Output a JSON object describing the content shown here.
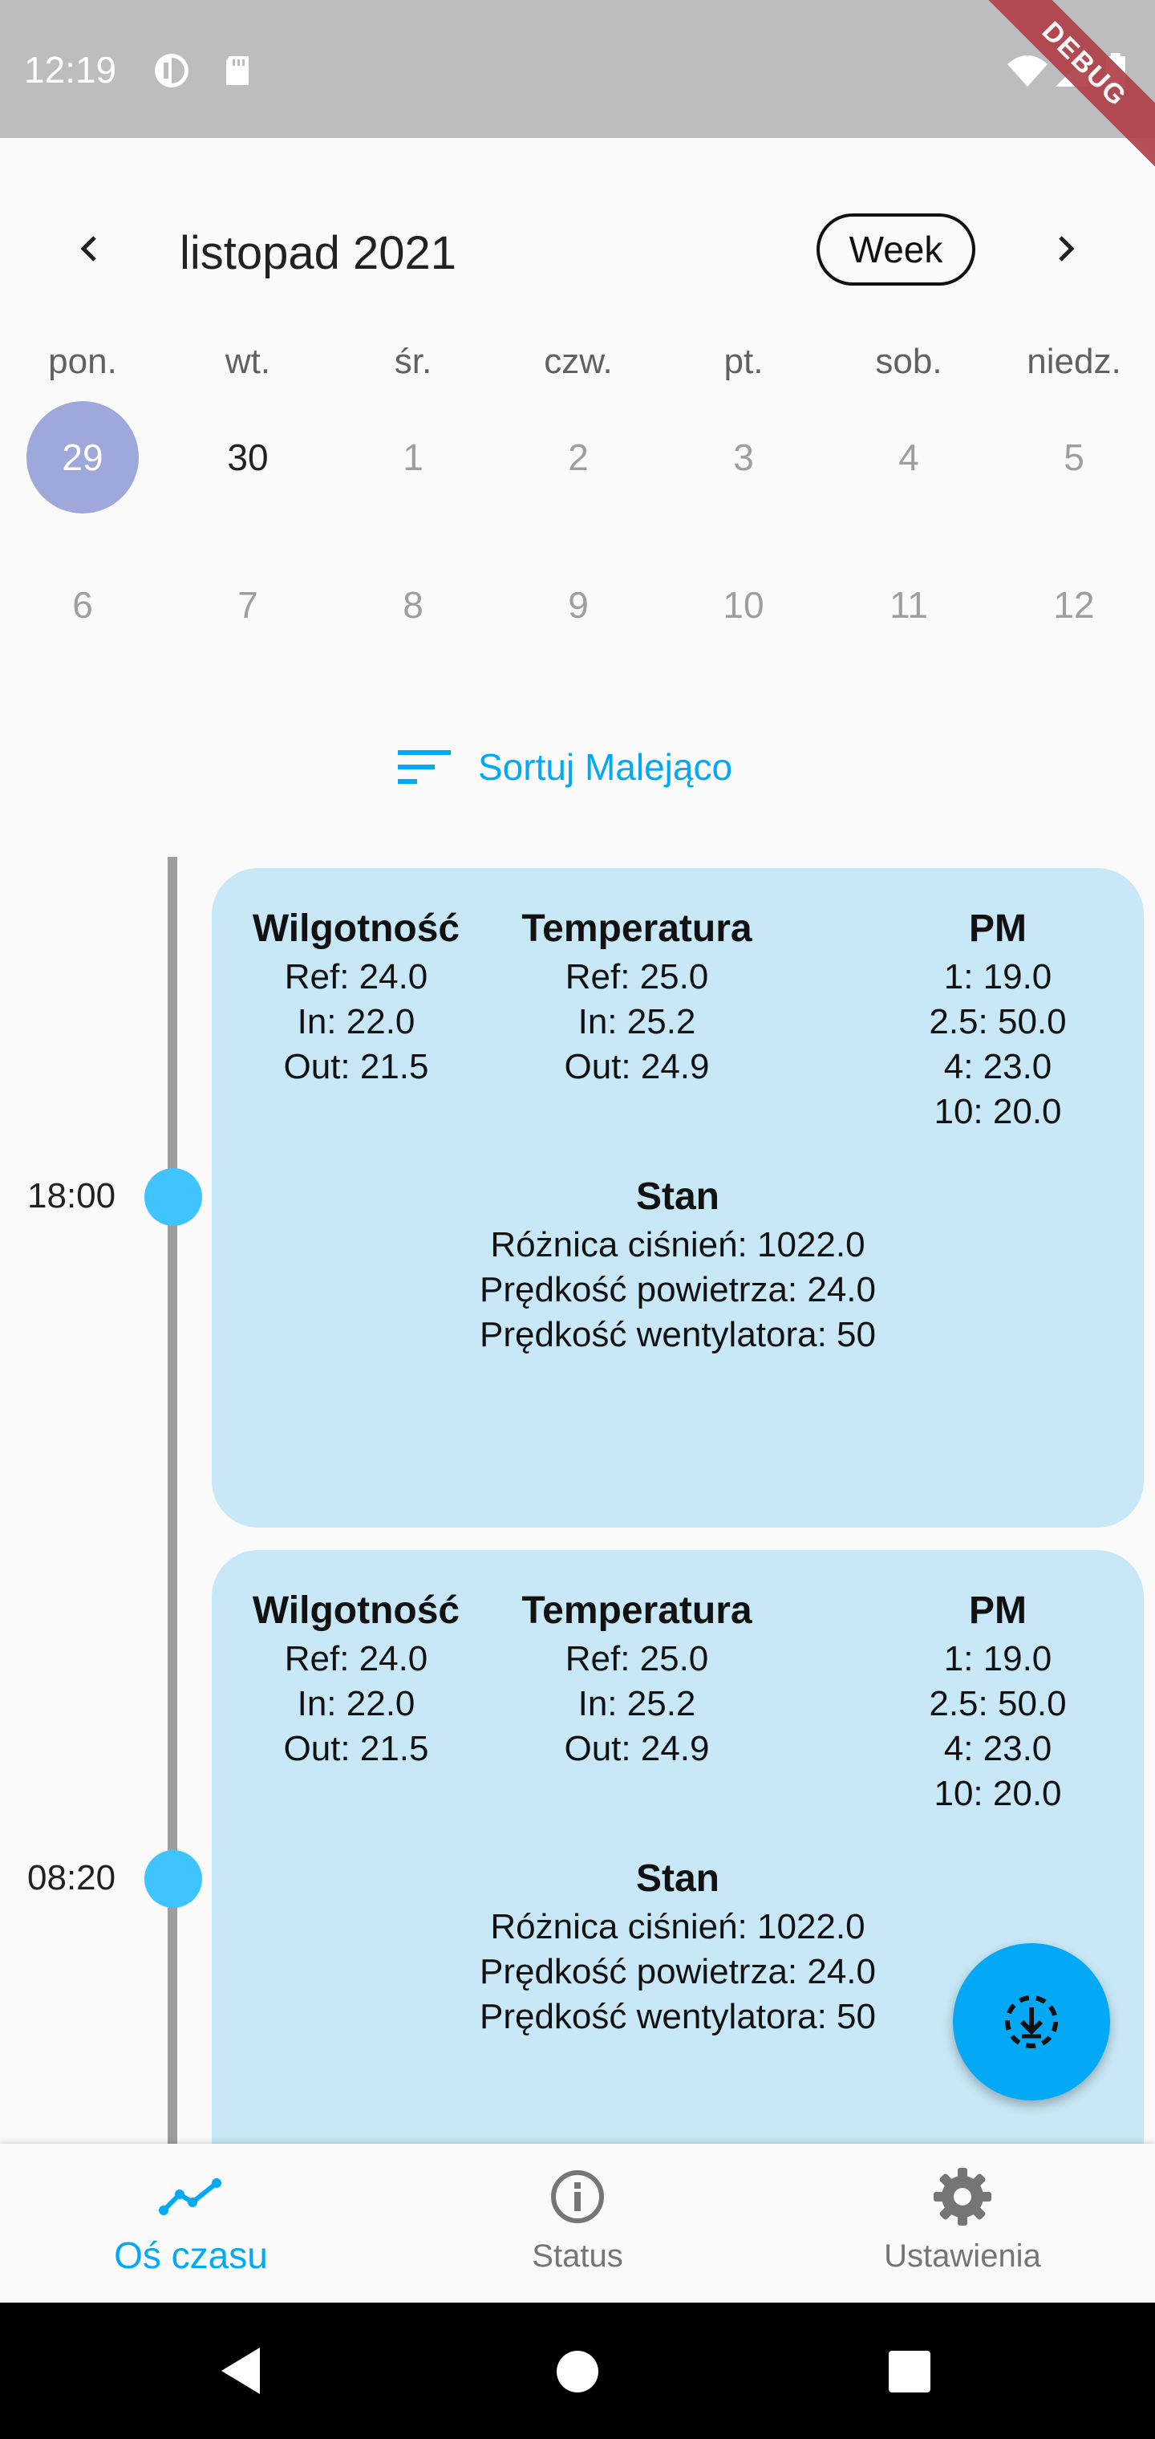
{
  "status_bar": {
    "time": "12:19",
    "debug_label": "DEBUG"
  },
  "calendar": {
    "month_title": "listopad 2021",
    "view_button": "Week",
    "weekdays": [
      "pon.",
      "wt.",
      "śr.",
      "czw.",
      "pt.",
      "sob.",
      "niedz."
    ],
    "week1": [
      "29",
      "30",
      "1",
      "2",
      "3",
      "4",
      "5"
    ],
    "week2": [
      "6",
      "7",
      "8",
      "9",
      "10",
      "11",
      "12"
    ]
  },
  "sort_label": "Sortuj Malejąco",
  "entries": [
    {
      "time": "18:00",
      "humidity": {
        "title": "Wilgotność",
        "ref": "Ref: 24.0",
        "in": "In: 22.0",
        "out": "Out: 21.5"
      },
      "temperature": {
        "title": "Temperatura",
        "ref": "Ref: 25.0",
        "in": "In: 25.2",
        "out": "Out: 24.9"
      },
      "pm": {
        "title": "PM",
        "pm1": "1: 19.0",
        "pm25": "2.5: 50.0",
        "pm4": "4: 23.0",
        "pm10": "10: 20.0"
      },
      "state": {
        "title": "Stan",
        "pressure": "Różnica ciśnień: 1022.0",
        "air_speed": "Prędkość powietrza: 24.0",
        "fan_speed": "Prędkość wentylatora: 50"
      }
    },
    {
      "time": "08:20",
      "humidity": {
        "title": "Wilgotność",
        "ref": "Ref: 24.0",
        "in": "In: 22.0",
        "out": "Out: 21.5"
      },
      "temperature": {
        "title": "Temperatura",
        "ref": "Ref: 25.0",
        "in": "In: 25.2",
        "out": "Out: 24.9"
      },
      "pm": {
        "title": "PM",
        "pm1": "1: 19.0",
        "pm25": "2.5: 50.0",
        "pm4": "4: 23.0",
        "pm10": "10: 20.0"
      },
      "state": {
        "title": "Stan",
        "pressure": "Różnica ciśnień: 1022.0",
        "air_speed": "Prędkość powietrza: 24.0",
        "fan_speed": "Prędkość wentylatora: 50"
      }
    }
  ],
  "bottom_nav": [
    {
      "label": "Oś czasu",
      "icon": "timeline-icon",
      "active": true
    },
    {
      "label": "Status",
      "icon": "info-icon",
      "active": false
    },
    {
      "label": "Ustawienia",
      "icon": "gear-icon",
      "active": false
    }
  ],
  "colors": {
    "accent": "#03a9f4",
    "card": "#c8e8f7",
    "selected_day": "#9fa8da",
    "timeline_dot": "#40c4ff"
  }
}
